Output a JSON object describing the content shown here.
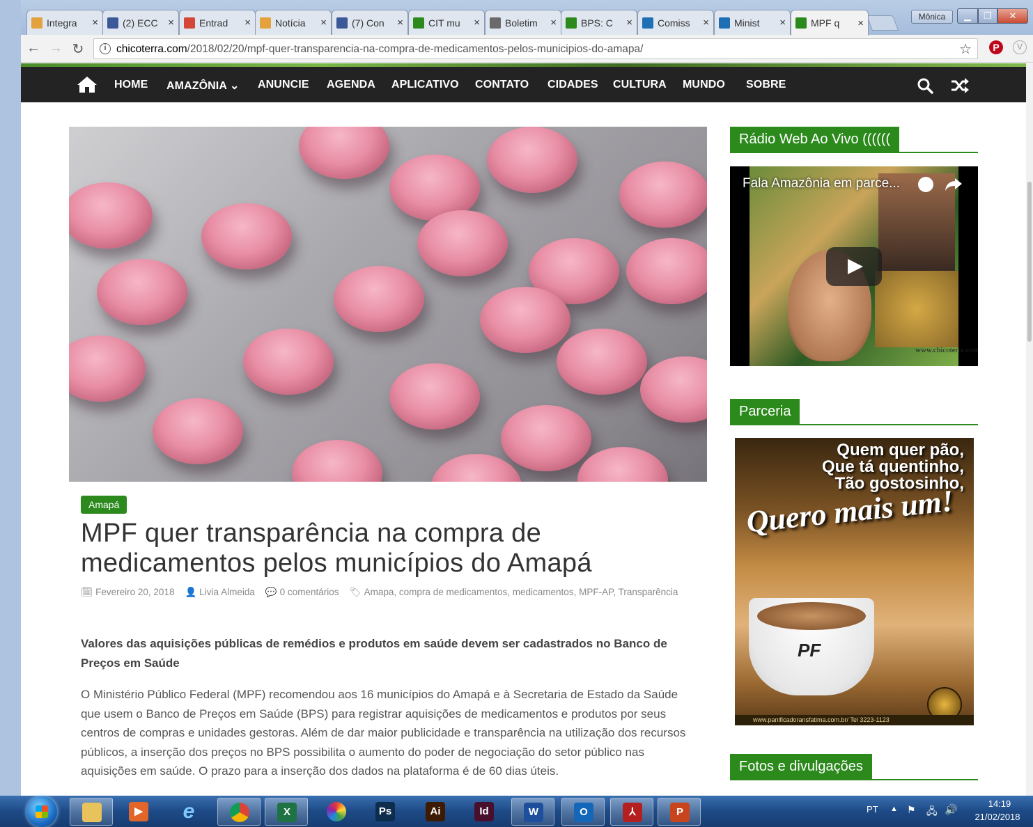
{
  "browser": {
    "tabs": [
      {
        "label": "Integra",
        "icon": "chrome-icon",
        "color": "#e3a23b"
      },
      {
        "label": "(2) ECC",
        "icon": "facebook-icon",
        "color": "#3b5998"
      },
      {
        "label": "Entrad",
        "icon": "gmail-icon",
        "color": "#d44638"
      },
      {
        "label": "Notícia",
        "icon": "chrome-icon",
        "color": "#e3a23b"
      },
      {
        "label": "(7) Con",
        "icon": "facebook-icon",
        "color": "#3b5998"
      },
      {
        "label": "CIT mu",
        "icon": "gov-icon",
        "color": "#2c8a1d"
      },
      {
        "label": "Boletim",
        "icon": "boletim-icon",
        "color": "#6a6a6a"
      },
      {
        "label": "BPS: C",
        "icon": "gov-icon",
        "color": "#2c8a1d"
      },
      {
        "label": "Comiss",
        "icon": "bookmark-icon",
        "color": "#1f6fb5"
      },
      {
        "label": "Minist",
        "icon": "bookmark-icon",
        "color": "#1f6fb5"
      },
      {
        "label": "MPF q",
        "icon": "site-icon",
        "color": "#2c8a1d"
      }
    ],
    "close_glyph": "×",
    "user_name": "Mônica",
    "url_domain": "chicoterra.com",
    "url_path": "/2018/02/20/mpf-quer-transparencia-na-compra-de-medicamentos-pelos-municipios-do-amapa/"
  },
  "nav": {
    "items": [
      "HOME",
      "AMAZÔNIA ⌄",
      "ANUNCIE",
      "AGENDA",
      "APLICATIVO",
      "CONTATO",
      "CIDADES",
      "CULTURA",
      "MUNDO",
      "SOBRE"
    ]
  },
  "article": {
    "category": "Amapá",
    "title": "MPF quer transparência na compra de medicamentos pelos municípios do Amapá",
    "date": "Fevereiro 20, 2018",
    "author": "Livia Almeida",
    "comments": "0 comentários",
    "tags": [
      "Amapa",
      "compra de medicamentos",
      "medicamentos",
      "MPF-AP",
      "Transparência"
    ],
    "lead": "Valores das aquisições públicas de remédios e produtos em saúde devem ser cadastrados no Banco de Preços em Saúde",
    "body": "O Ministério Público Federal (MPF) recomendou aos 16 municípios do Amapá e à Secretaria de Estado da Saúde que usem o Banco de Preços em Saúde (BPS) para registrar aquisições de medicamentos e produtos por seus centros de compras e unidades gestoras. Além de dar maior publicidade e transparência na utilização dos recursos públicos, a inserção dos preços no BPS possibilita o aumento do poder de negociação do setor público nas aquisições em saúde. O prazo para a inserção dos dados na plataforma é de 60 dias úteis."
  },
  "sidebar": {
    "radio_title": "Rádio Web Ao Vivo ((((((",
    "video_title": "Fala Amazônia em parce...",
    "video_watermark": "www.chicoterra.com",
    "partner_title": "Parceria",
    "ad_lines": [
      "Quem quer pão,",
      "Que tá quentinho,",
      "Tão gostosinho,"
    ],
    "ad_script": "Quero mais um!",
    "ad_logo": "PF",
    "ad_footer": "www.panificadoransfatima.com.br/ Tel 3223-1123",
    "photos_title": "Fotos e divulgações"
  },
  "taskbar": {
    "apps": [
      {
        "name": "explorer",
        "label": "",
        "color": "#e8c25a"
      },
      {
        "name": "media-player",
        "label": "▶",
        "color": "#e2662a"
      },
      {
        "name": "internet-explorer",
        "label": "e",
        "color": "#2a8ad8"
      },
      {
        "name": "chrome",
        "label": "",
        "color": "#d8452f"
      },
      {
        "name": "excel",
        "label": "X",
        "color": "#1f7244"
      },
      {
        "name": "picasa",
        "label": "",
        "color": "#8a4fb8"
      },
      {
        "name": "photoshop",
        "label": "Ps",
        "color": "#0d2d4d"
      },
      {
        "name": "illustrator",
        "label": "Ai",
        "color": "#3d1b03"
      },
      {
        "name": "indesign",
        "label": "Id",
        "color": "#48102c"
      },
      {
        "name": "word",
        "label": "W",
        "color": "#1e4f9c"
      },
      {
        "name": "outlook",
        "label": "O",
        "color": "#1466b8"
      },
      {
        "name": "acrobat",
        "label": "⅄",
        "color": "#b41f1f"
      },
      {
        "name": "powerpoint",
        "label": "P",
        "color": "#c8441d"
      }
    ],
    "lang": "PT",
    "time": "14:19",
    "date": "21/02/2018"
  },
  "colors": {
    "accent": "#2c8a1d",
    "nav_bg": "#232323"
  }
}
